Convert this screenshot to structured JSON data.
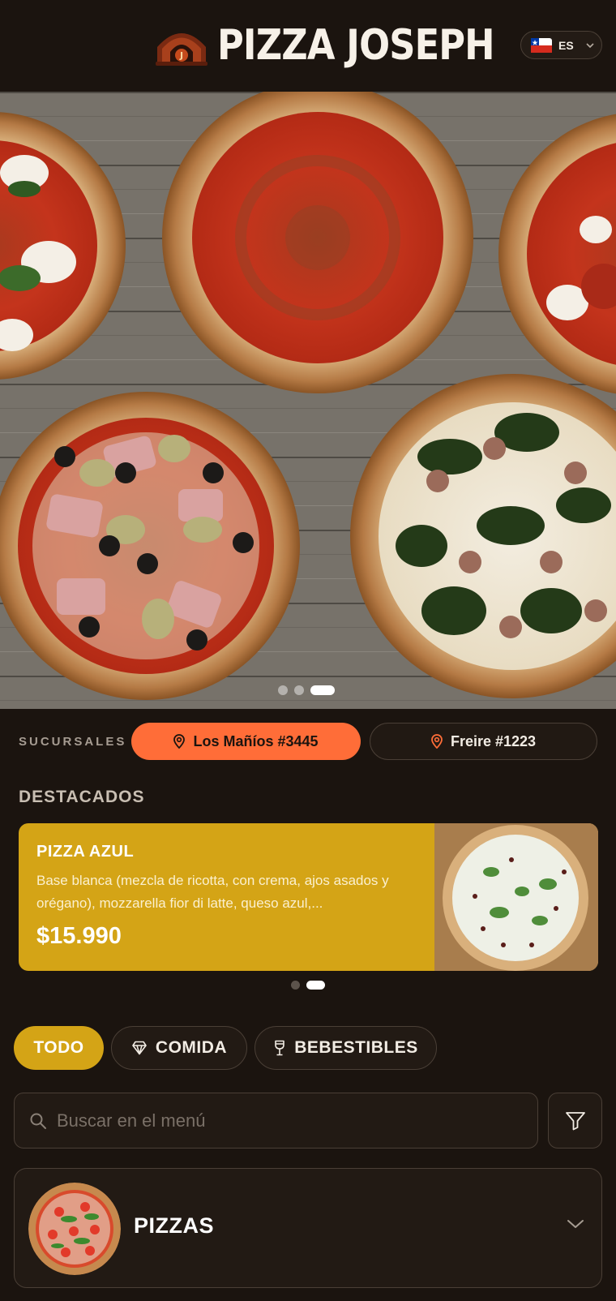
{
  "header": {
    "brand_name": "PIZZA JOSEPH",
    "language": {
      "code": "ES",
      "flag": "chile-flag-icon"
    }
  },
  "hero": {
    "slides_count": 3,
    "active_slide": 3
  },
  "branches": {
    "label": "SUCURSALES",
    "items": [
      {
        "name": "Los Mañíos #3445",
        "selected": true
      },
      {
        "name": "Freire #1223",
        "selected": false
      }
    ]
  },
  "featured": {
    "title": "DESTACADOS",
    "item": {
      "name": "PIZZA AZUL",
      "description": "Base blanca (mezcla de ricotta, con crema, ajos asados y orégano), mozzarella fior di latte, queso azul,...",
      "price": "$15.990"
    },
    "slides_count": 2,
    "active_slide": 2
  },
  "tabs": [
    {
      "label": "TODO",
      "icon": "",
      "active": true
    },
    {
      "label": "COMIDA",
      "icon": "diamond-icon",
      "active": false
    },
    {
      "label": "BEBESTIBLES",
      "icon": "drink-cup-icon",
      "active": false
    }
  ],
  "search": {
    "placeholder": "Buscar en el menú",
    "value": ""
  },
  "categories": [
    {
      "name": "PIZZAS"
    }
  ],
  "colors": {
    "background": "#1b140f",
    "accent_orange": "#ff6d38",
    "accent_gold": "#d4a416"
  }
}
